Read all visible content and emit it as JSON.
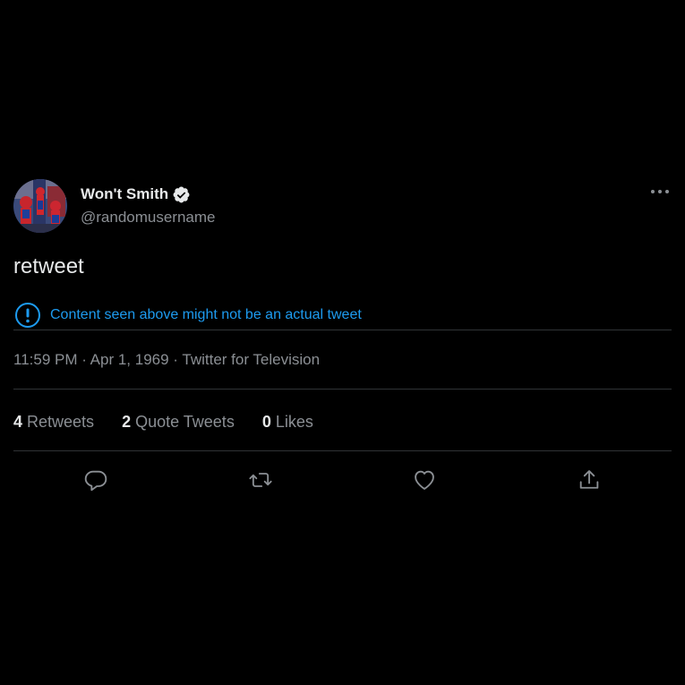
{
  "tweet": {
    "display_name": "Won't Smith",
    "username": "@randomusername",
    "text": "retweet",
    "notice": "Content seen above might not be an actual tweet",
    "meta": "11:59 PM · Apr 1, 1969 · Twitter for Television",
    "stats": {
      "retweets_count": "4",
      "retweets_label": " Retweets",
      "quotes_count": "2",
      "quotes_label": " Quote Tweets",
      "likes_count": "0",
      "likes_label": " Likes"
    },
    "icons": {
      "verified": "verified-badge-icon",
      "more": "more-options-icon",
      "notice": "exclamation-circle-icon",
      "reply": "reply-icon",
      "retweet": "retweet-icon",
      "like": "heart-icon",
      "share": "share-icon"
    }
  },
  "colors": {
    "background": "#000000",
    "primary_text": "#e7e9ea",
    "secondary_text": "#8b8f94",
    "link_blue": "#1d9bf0",
    "divider": "#2f3336"
  }
}
